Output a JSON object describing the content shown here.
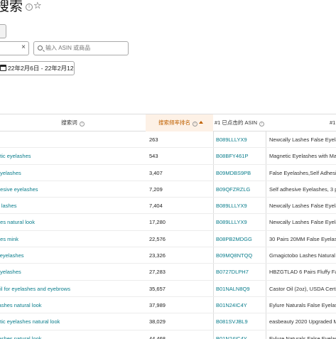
{
  "page": {
    "title": "搜索",
    "info_glyph": "i",
    "star_glyph": "☆"
  },
  "filters": {
    "select_clear": "×",
    "search_placeholder": "输入 ASIN 或商品",
    "date_range": "22年2月6日 - 22年2月12"
  },
  "table": {
    "headers": {
      "keyword": "搜索词",
      "rank": "搜索频率排名",
      "asin": "#1 已点击的 ASIN",
      "product": "#1"
    },
    "rows": [
      {
        "keyword": "s",
        "rank": "263",
        "asin": "B089LLLYX9",
        "product": "Newcally Lashes False Eyelash"
      },
      {
        "keyword": "etic eyelashes",
        "rank": "543",
        "asin": "B08BFY461P",
        "product": "Magnetic Eyelashes with Mag"
      },
      {
        "keyword": "eyelashes",
        "rank": "3,407",
        "asin": "B09MDBS9PB",
        "product": "False Eyelashes,Self Adhesive"
      },
      {
        "keyword": "hesive eyelashes",
        "rank": "7,209",
        "asin": "B09QFZRZLG",
        "product": "Self adhesive Eyelashes, 3 pai"
      },
      {
        "keyword": "s lashes",
        "rank": "7,404",
        "asin": "B089LLLYX9",
        "product": "Newcally Lashes False Eyelash"
      },
      {
        "keyword": "hes natural look",
        "rank": "17,280",
        "asin": "B089LLLYX9",
        "product": "Newcally Lashes False Eyelash"
      },
      {
        "keyword": "hes mink",
        "rank": "22,576",
        "asin": "B08PB2MDGG",
        "product": "30 Pairs 20MM False Eyelash"
      },
      {
        "keyword": "l eyelashes",
        "rank": "23,326",
        "asin": "B09MQ8NTQQ",
        "product": "Gmagictobo Lashes Natural Lo"
      },
      {
        "keyword": "eyelashes",
        "rank": "27,283",
        "asin": "B0727DLPH7",
        "product": "HBZGTLAD 6 Pairs Fluffy False"
      },
      {
        "keyword": "oil for eyelashes and eyebrows",
        "rank": "35,657",
        "asin": "B01NALN8Q9",
        "product": "Castor Oil (2oz), USDA Certifie"
      },
      {
        "keyword": "lashes natural look",
        "rank": "37,989",
        "asin": "B01N24IC4Y",
        "product": "Eylure Naturals False Eyelash"
      },
      {
        "keyword": "etic eyelashes natural look",
        "rank": "38,029",
        "asin": "B081SVJBL9",
        "product": "easbeauty 2020 Upgraded Mag"
      },
      {
        "keyword": "lashes natural look",
        "rank": "44,468",
        "asin": "B01N24IC4Y",
        "product": "Eylure Naturals False Eyelash"
      }
    ]
  }
}
